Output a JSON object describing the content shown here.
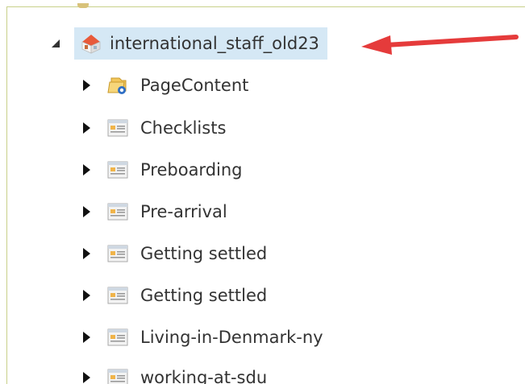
{
  "tree": {
    "root": {
      "label": "international_staff_old23",
      "icon": "home-icon",
      "expanded": true,
      "selected": true
    },
    "children": [
      {
        "label": "PageContent",
        "icon": "folder-icon"
      },
      {
        "label": "Checklists",
        "icon": "page-icon"
      },
      {
        "label": "Preboarding",
        "icon": "page-icon"
      },
      {
        "label": "Pre-arrival",
        "icon": "page-icon"
      },
      {
        "label": "Getting settled",
        "icon": "page-icon"
      },
      {
        "label": "Getting settled",
        "icon": "page-icon"
      },
      {
        "label": "Living-in-Denmark-ny",
        "icon": "page-icon"
      },
      {
        "label": "working-at-sdu",
        "icon": "page-icon"
      }
    ]
  },
  "annotation": {
    "arrow_color": "#e53b3b"
  },
  "colors": {
    "selection_bg": "#d5e8f5",
    "border": "#c8d08a",
    "text": "#333333"
  }
}
